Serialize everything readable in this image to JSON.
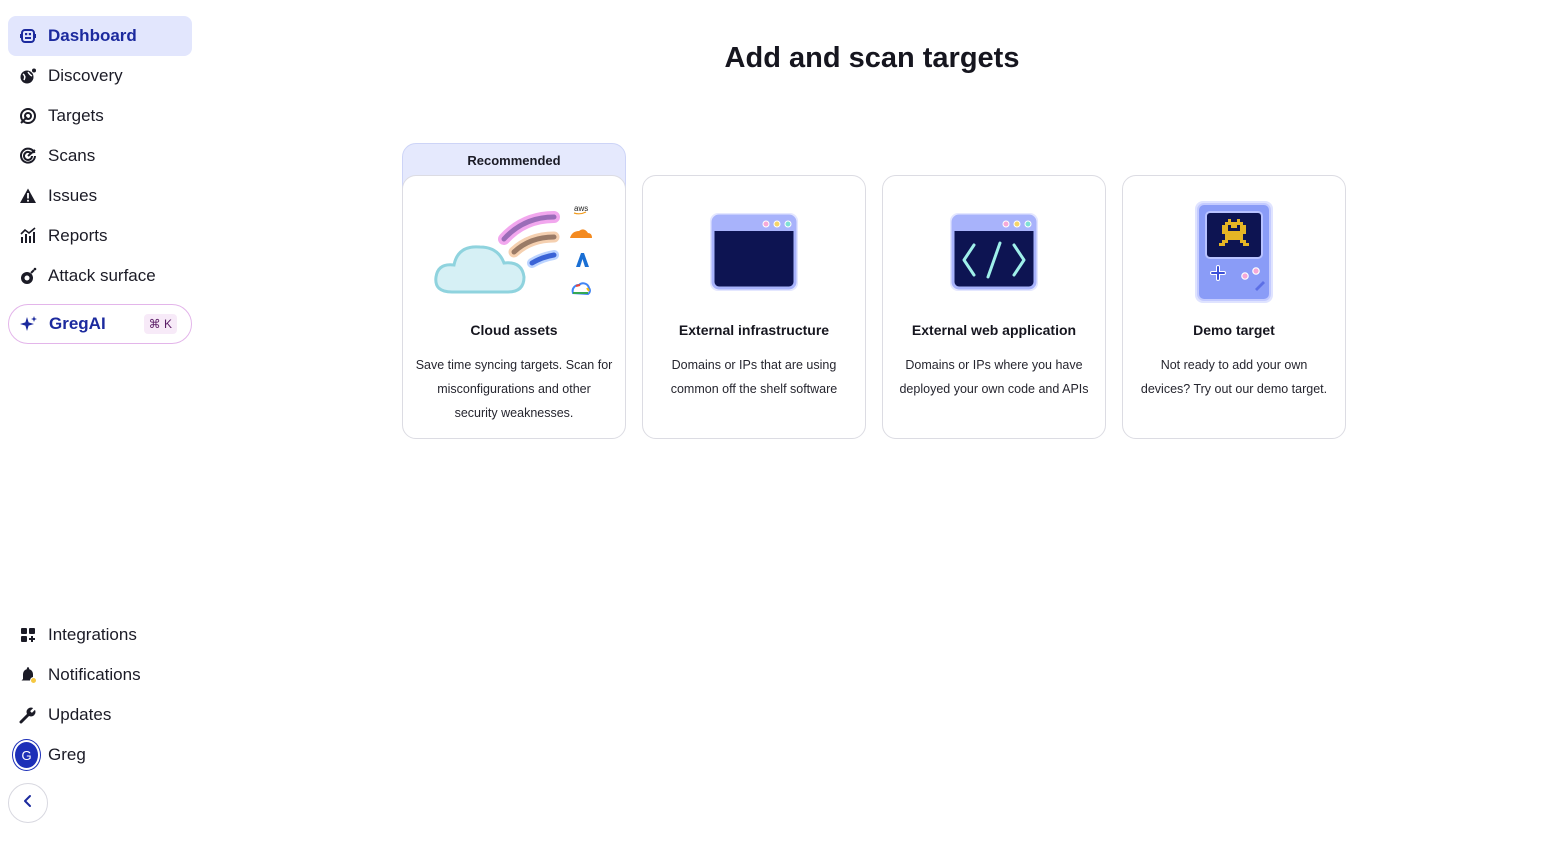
{
  "sidebar": {
    "nav": [
      {
        "label": "Dashboard",
        "icon": "dashboard-icon",
        "active": true
      },
      {
        "label": "Discovery",
        "icon": "globe-icon"
      },
      {
        "label": "Targets",
        "icon": "target-icon"
      },
      {
        "label": "Scans",
        "icon": "radar-icon"
      },
      {
        "label": "Issues",
        "icon": "warning-icon"
      },
      {
        "label": "Reports",
        "icon": "chart-icon"
      },
      {
        "label": "Attack surface",
        "icon": "bomb-icon"
      }
    ],
    "gregai": {
      "label": "GregAI",
      "shortcut": "⌘ K",
      "icon": "sparkle-icon"
    },
    "bottom": [
      {
        "label": "Integrations",
        "icon": "grid-plus-icon"
      },
      {
        "label": "Notifications",
        "icon": "bell-icon"
      },
      {
        "label": "Updates",
        "icon": "wrench-icon"
      }
    ],
    "user": {
      "name": "Greg",
      "initial": "G"
    },
    "collapse_icon": "chevron-left-icon"
  },
  "main": {
    "title": "Add and scan targets",
    "recommended_label": "Recommended",
    "cards": [
      {
        "title": "Cloud assets",
        "desc": "Save time syncing targets. Scan for misconfigurations and other security weaknesses.",
        "illustration": "cloud-illustration",
        "provider_logo_text": "aws"
      },
      {
        "title": "External infrastructure",
        "desc": "Domains or IPs that are using common off the shelf software",
        "illustration": "browser-window-illustration"
      },
      {
        "title": "External web application",
        "desc": "Domains or IPs where you have deployed your own code and APIs",
        "illustration": "code-window-illustration"
      },
      {
        "title": "Demo target",
        "desc": "Not ready to add your own devices? Try out our demo target.",
        "illustration": "game-console-illustration"
      }
    ]
  },
  "colors": {
    "accent": "#1c2a9e",
    "active_bg": "#e2e6fd",
    "card_border": "#dcdce3",
    "illustration_navy": "#0d1452",
    "illustration_lilac": "#a8b3fb"
  }
}
